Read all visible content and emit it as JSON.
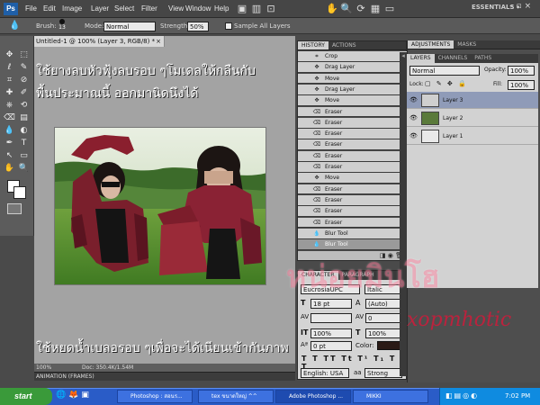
{
  "app": {
    "logo": "Ps",
    "workspace": "ESSENTIALS ▾"
  },
  "menus": [
    "File",
    "Edit",
    "Image",
    "Layer",
    "Select",
    "Filter",
    "View",
    "Window",
    "Help"
  ],
  "options": {
    "brush_label": "Brush:",
    "brush_size": "13",
    "mode_label": "Mode:",
    "mode_value": "Normal",
    "strength_label": "Strength:",
    "strength_value": "50%",
    "sample_all_label": "Sample All Layers"
  },
  "document": {
    "tab_title": "Untitled-1 @ 100% (Layer 3, RGB/8) *",
    "zoom": "100%",
    "doc_info": "Doc: 350.4K/1.54M",
    "tip_top_line1": "ใช้ยางลบหัวฟุ้งลบรอบ ๆโมเดลให้กลืนกับ",
    "tip_top_line2": "พื้นประมาณนี้ ออกมานิดนึงได้",
    "tip_bottom": "ใช้หยดน้ำเบลอรอบ ๆเพื่อจะได้เนียนเข้ากันภาพ",
    "animation_label": "ANIMATION (FRAMES)"
  },
  "history": {
    "tabs": [
      "HISTORY",
      "ACTIONS"
    ],
    "items": [
      {
        "icon": "⌗",
        "label": "Crop"
      },
      {
        "icon": "✥",
        "label": "Drag Layer"
      },
      {
        "icon": "✥",
        "label": "Move"
      },
      {
        "icon": "✥",
        "label": "Drag Layer"
      },
      {
        "icon": "✥",
        "label": "Move"
      },
      {
        "icon": "⌫",
        "label": "Eraser"
      },
      {
        "icon": "⌫",
        "label": "Eraser"
      },
      {
        "icon": "⌫",
        "label": "Eraser"
      },
      {
        "icon": "⌫",
        "label": "Eraser"
      },
      {
        "icon": "⌫",
        "label": "Eraser"
      },
      {
        "icon": "⌫",
        "label": "Eraser"
      },
      {
        "icon": "✥",
        "label": "Move"
      },
      {
        "icon": "⌫",
        "label": "Eraser"
      },
      {
        "icon": "⌫",
        "label": "Eraser"
      },
      {
        "icon": "⌫",
        "label": "Eraser"
      },
      {
        "icon": "⌫",
        "label": "Eraser"
      },
      {
        "icon": "💧",
        "label": "Blur Tool"
      },
      {
        "icon": "💧",
        "label": "Blur Tool"
      }
    ]
  },
  "character": {
    "tabs": [
      "CHARACTER",
      "PARAGRAPH"
    ],
    "font": "EucrosiaUPC",
    "style": "Italic",
    "size": "18 pt",
    "leading": "(Auto)",
    "kerning": "0",
    "vscale": "100%",
    "hscale": "100%",
    "baseline": "0 pt",
    "color_label": "Color:",
    "language": "English: USA",
    "aa_label": "aa",
    "aa_value": "Strong"
  },
  "adjustments": {
    "tabs": [
      "ADJUSTMENTS",
      "MASKS"
    ]
  },
  "layers": {
    "tabs": [
      "LAYERS",
      "CHANNELS",
      "PATHS"
    ],
    "blend_mode": "Normal",
    "opacity_label": "Opacity:",
    "opacity": "100%",
    "lock_label": "Lock:",
    "fill_label": "Fill:",
    "fill": "100%",
    "items": [
      {
        "name": "Layer 3",
        "selected": true
      },
      {
        "name": "Layer 2",
        "selected": false
      },
      {
        "name": "Layer 1",
        "selected": false
      }
    ]
  },
  "watermark": {
    "thai": "หน่อยมินโฮ",
    "latin": "xopmhotic"
  },
  "taskbar": {
    "start": "start",
    "tasks": [
      {
        "label": "Photoshop : สอนร...",
        "active": false
      },
      {
        "label": "tex ขนาดใหญ่ ^^",
        "active": false
      },
      {
        "label": "Adobe Photoshop ...",
        "active": true
      },
      {
        "label": "MIKKI",
        "active": false
      }
    ],
    "clock": "7:02 PM"
  }
}
